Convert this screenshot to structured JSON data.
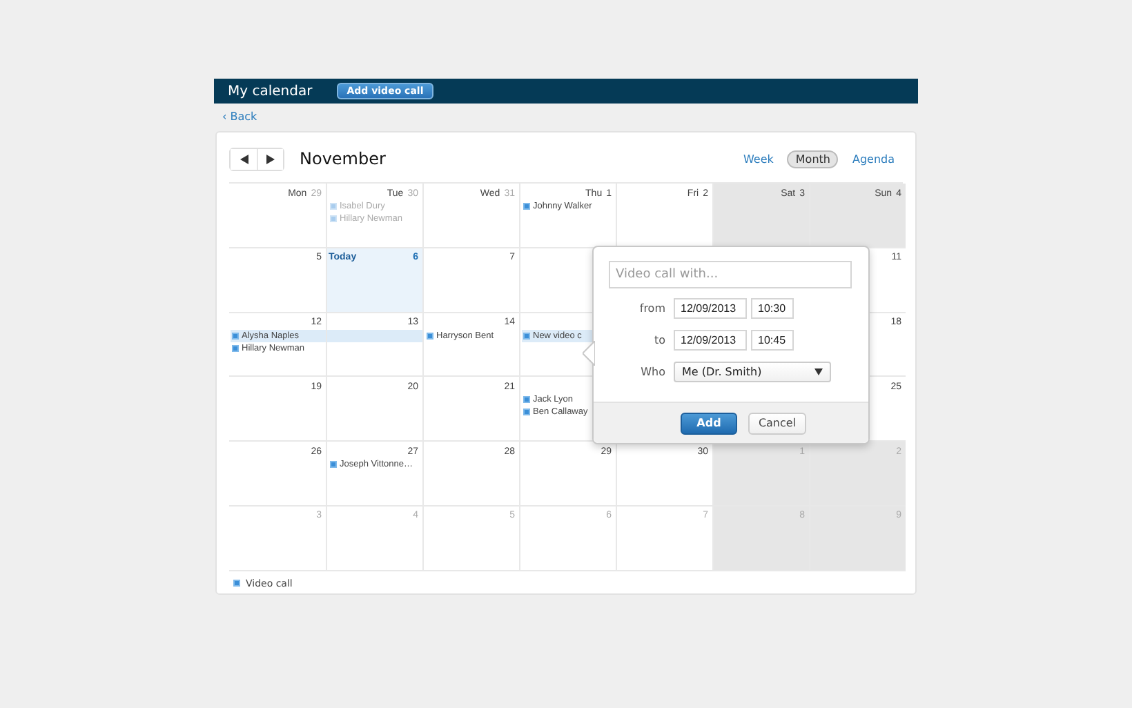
{
  "top_bar": {
    "title": "My calendar",
    "button": "Add video call"
  },
  "back_link": "‹ Back",
  "month": "November",
  "views": [
    {
      "label": "Week",
      "selected": false
    },
    {
      "label": "Month",
      "selected": true
    },
    {
      "label": "Agenda",
      "selected": false
    }
  ],
  "weeks": [
    [
      {
        "weekday": "Mon",
        "day": "29",
        "other_month": true,
        "shaded": false,
        "today": false
      },
      {
        "weekday": "Tue",
        "day": "30",
        "other_month": true,
        "shaded": false,
        "today": false,
        "events": [
          {
            "title": "Isabel Dury",
            "muted": true,
            "highlighted": false
          },
          {
            "title": "Hillary Newman",
            "muted": true,
            "highlighted": false
          }
        ]
      },
      {
        "weekday": "Wed",
        "day": "31",
        "other_month": true,
        "shaded": false,
        "today": false
      },
      {
        "weekday": "Thu",
        "day": "1",
        "other_month": false,
        "shaded": false,
        "today": false,
        "events": [
          {
            "title": "Johnny Walker",
            "muted": false,
            "highlighted": false
          }
        ]
      },
      {
        "weekday": "Fri",
        "day": "2",
        "other_month": false,
        "shaded": false,
        "today": false
      },
      {
        "weekday": "Sat",
        "day": "3",
        "other_month": false,
        "shaded": true,
        "today": false
      },
      {
        "weekday": "Sun",
        "day": "4",
        "other_month": false,
        "shaded": true,
        "today": false
      }
    ],
    [
      {
        "day": "5",
        "other_month": false,
        "shaded": false,
        "today": false
      },
      {
        "day": "6",
        "today_label": "Today",
        "other_month": false,
        "shaded": false,
        "today": true
      },
      {
        "day": "7",
        "other_month": false,
        "shaded": false,
        "today": false
      },
      {
        "day": "11",
        "other_month": false,
        "shaded": false,
        "today": false
      }
    ],
    [
      {
        "day": "12",
        "other_month": false,
        "shaded": false,
        "today": false,
        "events": [
          {
            "title": "Alysha Naples",
            "muted": false,
            "highlighted": true
          },
          {
            "title": "Hillary Newman",
            "muted": false,
            "highlighted": false
          }
        ]
      },
      {
        "day": "13",
        "other_month": false,
        "shaded": false,
        "today": false,
        "continued_event": true
      },
      {
        "day": "14",
        "other_month": false,
        "shaded": false,
        "today": false,
        "events": [
          {
            "title": "Harryson Bent",
            "muted": false,
            "highlighted": false
          }
        ]
      },
      {
        "events": [
          {
            "title": "New video c",
            "muted": false,
            "highlighted": true
          }
        ]
      },
      {
        "day": "18",
        "other_month": false,
        "shaded": false,
        "today": false
      }
    ],
    [
      {
        "day": "19",
        "other_month": false,
        "shaded": false,
        "today": false
      },
      {
        "day": "20",
        "other_month": false,
        "shaded": false,
        "today": false
      },
      {
        "day": "21",
        "other_month": false,
        "shaded": false,
        "today": false
      },
      {
        "events": [
          {
            "title": "Jack Lyon",
            "muted": false,
            "highlighted": false
          },
          {
            "title": "Ben Callaway",
            "muted": false,
            "highlighted": false
          }
        ]
      },
      {
        "day": "25",
        "other_month": false,
        "shaded": false,
        "today": false
      }
    ],
    [
      {
        "day": "26",
        "other_month": false,
        "shaded": false,
        "today": false
      },
      {
        "day": "27",
        "other_month": false,
        "shaded": false,
        "today": false,
        "events": [
          {
            "title": "Joseph Vittonne…",
            "muted": false,
            "highlighted": false
          }
        ]
      },
      {
        "day": "28",
        "other_month": false,
        "shaded": false,
        "today": false
      },
      {
        "day": "29",
        "other_month": false,
        "shaded": false,
        "today": false
      },
      {
        "day": "30",
        "other_month": false,
        "shaded": false,
        "today": false
      },
      {
        "day": "1",
        "other_month": true,
        "shaded": true,
        "today": false
      },
      {
        "day": "2",
        "other_month": true,
        "shaded": true,
        "today": false
      }
    ],
    [
      {
        "day": "3",
        "other_month": true,
        "shaded": false,
        "today": false
      },
      {
        "day": "4",
        "other_month": true,
        "shaded": false,
        "today": false
      },
      {
        "day": "5",
        "other_month": true,
        "shaded": false,
        "today": false
      },
      {
        "day": "6",
        "other_month": true,
        "shaded": false,
        "today": false
      },
      {
        "day": "7",
        "other_month": true,
        "shaded": false,
        "today": false
      },
      {
        "day": "8",
        "other_month": true,
        "shaded": true,
        "today": false
      },
      {
        "day": "9",
        "other_month": true,
        "shaded": true,
        "today": false
      }
    ]
  ],
  "popover": {
    "placeholder": "Video call with...",
    "from_label": "from",
    "from_date": "12/09/2013",
    "from_time": "10:30",
    "to_label": "to",
    "to_date": "12/09/2013",
    "to_time": "10:45",
    "who_label": "Who",
    "who": "Me (Dr. Smith)",
    "add": "Add",
    "cancel": "Cancel"
  },
  "legend": {
    "label": "Video call"
  }
}
